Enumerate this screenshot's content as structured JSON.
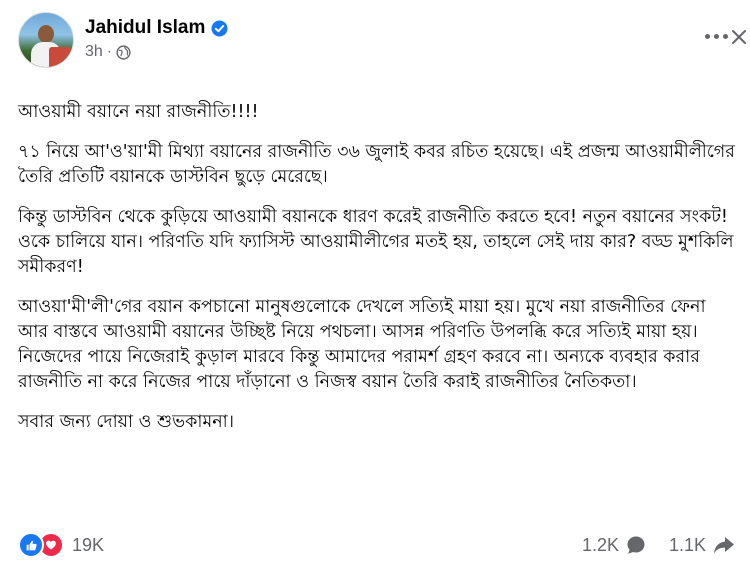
{
  "post": {
    "author": "Jahidul Islam",
    "time": "3h",
    "separator": "·",
    "paragraphs": [
      "আওয়ামী বয়ানে নয়া রাজনীতি!!!!",
      "৭১ নিয়ে আ'ও'য়া'মী মিথ্যা বয়ানের রাজনীতি ৩৬ জুলাই কবর রচিত হয়েছে। এই প্রজন্ম আওয়ামীলীগের তৈরি প্রতিটি বয়ানকে ডাস্টবিন ছুড়ে মেরেছে।",
      "কিন্তু ডাস্টবিন থেকে কুড়িয়ে আওয়ামী বয়ানকে ধারণ করেই রাজনীতি করতে হবে! নতুন বয়ানের সংকট! ওকে চালিয়ে যান। পরিণতি যদি ফ্যাসিস্ট আওয়ামীলীগের মতই হয়, তাহলে সেই দায় কার? বড্ড মুশকিলি সমীকরণ!",
      "আওয়া'মী'লী'গের বয়ান কপচানো মানুষগুলোকে দেখলে সত্যিই মায়া হয়। মুখে নয়া রাজনীতির ফেনা আর বাস্তবে আওয়ামী বয়ানের উচ্ছিষ্ট নিয়ে পথচলা। আসন্ন পরিণতি উপলব্ধি করে সত্যিই মায়া হয়। নিজেদের পায়ে নিজেরাই কুড়াল মারবে কিন্তু আমাদের পরামর্শ গ্রহণ করবে না। অন্যকে ব্যবহার করার রাজনীতি না করে নিজের পায়ে দাঁড়ানো ও নিজস্ব বয়ান তৈরি করাই রাজনীতির নৈতিকতা।",
      "সবার জন্য দোয়া ও শুভকামনা।"
    ]
  },
  "stats": {
    "reactions": "19K",
    "comments": "1.2K",
    "shares": "1.1K"
  },
  "icons": {
    "verified": "verified-badge-icon",
    "audience": "globe-icon",
    "more": "more-options-icon",
    "close": "close-icon",
    "like": "like-reaction-icon",
    "love": "love-reaction-icon",
    "comment": "comment-icon",
    "share": "share-icon"
  },
  "colors": {
    "brand_blue": "#1877f2",
    "love_red": "#f0284a",
    "secondary_text": "#65676b"
  }
}
